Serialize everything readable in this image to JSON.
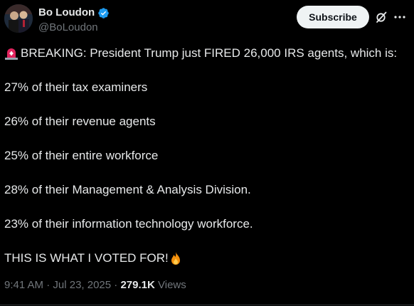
{
  "author": {
    "display_name": "Bo Loudon",
    "handle": "@BoLoudon",
    "verified": true
  },
  "actions": {
    "subscribe_label": "Subscribe",
    "grok_icon": "grok-icon",
    "more_icon": "more-icon"
  },
  "tweet": {
    "lead_icon": "police-siren-icon",
    "lines": [
      "BREAKING: President Trump just FIRED 26,000 IRS agents, which is:",
      "27% of their tax examiners",
      "26% of their revenue agents",
      "25% of their entire workforce",
      "28% of their Management & Analysis Division.",
      "23% of their information technology workforce.",
      "THIS IS WHAT I VOTED FOR!"
    ],
    "trailing_icon": "fire-icon"
  },
  "meta": {
    "time": "9:41 AM",
    "separator": " · ",
    "date": "Jul 23, 2025",
    "views_count": "279.1K",
    "views_label": "Views"
  },
  "colors": {
    "background": "#000000",
    "text": "#e7e9ea",
    "secondary_text": "#71767b",
    "verified": "#1d9bf0",
    "button_bg": "#eff3f4"
  }
}
